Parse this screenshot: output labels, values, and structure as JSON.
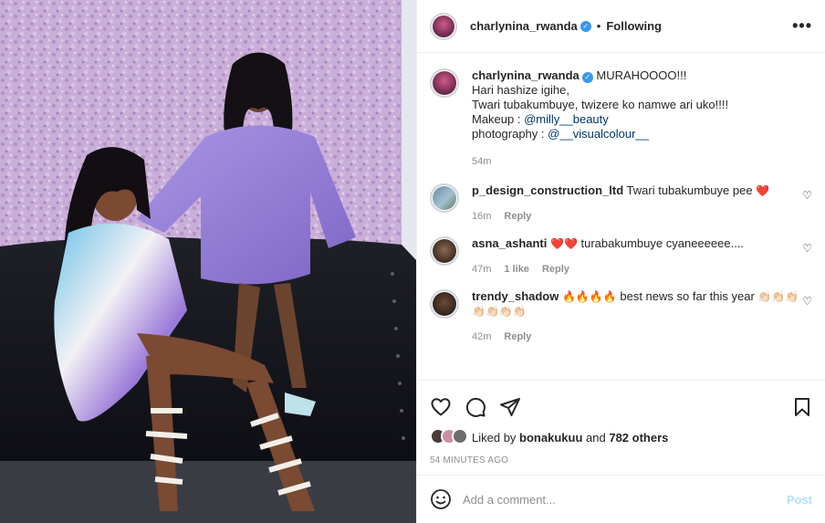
{
  "post": {
    "username": "charlynina_rwanda",
    "separator": "•",
    "follow_state": "Following",
    "more_label": "•••"
  },
  "caption": {
    "username": "charlynina_rwanda",
    "line1": "MURAHOOOO!!!",
    "line2": "Hari hashize igihe,",
    "line3": "Twari tubakumbuye, twizere ko namwe ari uko!!!!",
    "makeup_prefix": "Makeup : ",
    "makeup_handle": "@milly__beauty",
    "photo_prefix": "photography : ",
    "photo_handle": "@__visualcolour__",
    "time": "54m"
  },
  "comments": [
    {
      "username": "p_design_construction_ltd",
      "text": "Twari tubakumbuye pee",
      "emoji": "❤️",
      "time": "16m",
      "reply": "Reply",
      "avatar_color": "#8aa6b8"
    },
    {
      "username": "asna_ashanti",
      "emoji_pre": "❤️❤️",
      "text": "turabakumbuye cyaneeeeee....",
      "time": "47m",
      "likes": "1 like",
      "reply": "Reply",
      "avatar_color": "#5b4636"
    },
    {
      "username": "trendy_shadow",
      "emoji_pre": "🔥🔥🔥🔥",
      "text": "best news so far this year",
      "emoji_post": "👏🏻👏🏻👏🏻",
      "emoji_line2": "👏🏻👏🏻👏🏻👏🏻",
      "time": "42m",
      "reply": "Reply",
      "avatar_color": "#3a2a22"
    }
  ],
  "likes": {
    "prefix": "Liked by ",
    "user": "bonakukuu",
    "middle": " and ",
    "count": "782 others"
  },
  "timestamp": "54 MINUTES AGO",
  "add_comment": {
    "placeholder": "Add a comment...",
    "post_label": "Post"
  },
  "colors": {
    "accent_blue": "#0095f6",
    "post_disabled": "#b2dffc",
    "heart_red": "#ed4956",
    "wall_purple": "#c8a7d6",
    "dress_lilac": "#9c85d8"
  }
}
